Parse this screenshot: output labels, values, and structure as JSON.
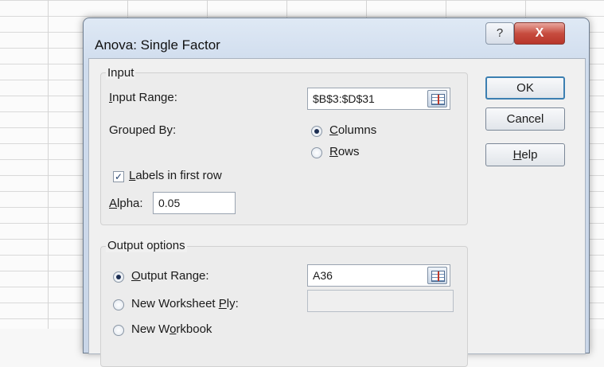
{
  "dialog": {
    "title": "Anova: Single Factor",
    "help_icon": "?",
    "close_icon": "X"
  },
  "input": {
    "group_label": "Input",
    "range_label_u": "I",
    "range_label_rest": "nput Range:",
    "range_value": "$B$3:$D$31",
    "grouped_by_label": "Grouped By:",
    "columns_u": "C",
    "columns_rest": "olumns",
    "rows_u": "R",
    "rows_rest": "ows",
    "grouped_by_selected": "Columns",
    "labels_u": "L",
    "labels_rest": "abels in first row",
    "labels_checked": true,
    "alpha_u": "A",
    "alpha_rest": "lpha:",
    "alpha_value": "0.05"
  },
  "output": {
    "group_label": "Output options",
    "output_range_u": "O",
    "output_range_rest": "utput Range:",
    "output_range_value": "A36",
    "new_ply_prefix": "New Worksheet ",
    "new_ply_u": "P",
    "new_ply_rest": "ly:",
    "new_workbook_prefix": "New W",
    "new_workbook_u": "o",
    "new_workbook_rest": "rkbook",
    "selected": "Output Range"
  },
  "buttons": {
    "ok": "OK",
    "cancel": "Cancel",
    "help_u": "H",
    "help_rest": "elp"
  },
  "icons": {
    "checkbox_check": "✓"
  }
}
